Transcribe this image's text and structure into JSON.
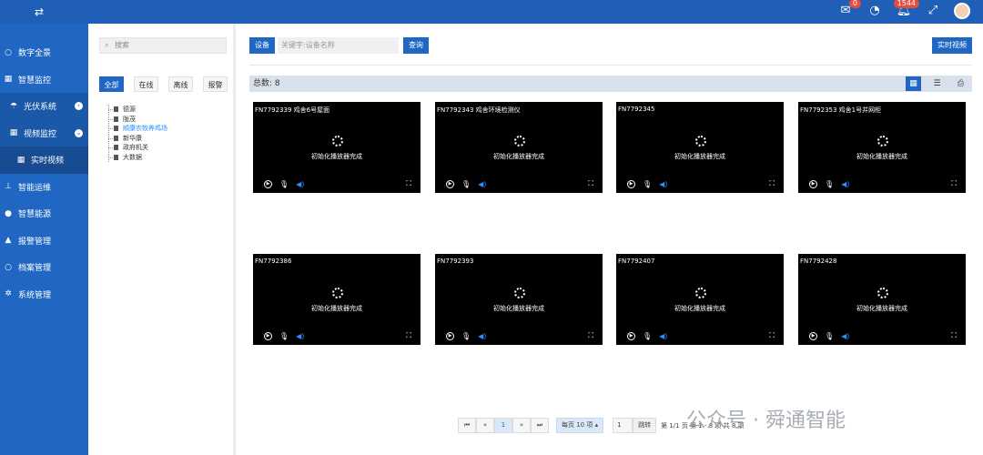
{
  "topbar": {
    "toggle_icon": "swap-icon",
    "mail_badge": "0",
    "alarm_badge": "1544"
  },
  "sidebar": {
    "items": [
      {
        "label": "数字全景",
        "icon": "circle-icon"
      },
      {
        "label": "智慧监控",
        "icon": "grid-icon"
      },
      {
        "label": "光伏系统",
        "icon": "solar-icon"
      },
      {
        "label": "视频监控",
        "icon": "grid-icon"
      },
      {
        "label": "实时视频",
        "icon": "grid-icon"
      },
      {
        "label": "智能运维",
        "icon": "sitemap-icon"
      },
      {
        "label": "智慧能源",
        "icon": "dot-icon"
      },
      {
        "label": "报警管理",
        "icon": "bell-icon"
      },
      {
        "label": "档案管理",
        "icon": "circle-icon"
      },
      {
        "label": "系统管理",
        "icon": "gear-icon"
      }
    ]
  },
  "tree": {
    "search_placeholder": "搜索",
    "filters": [
      "全部",
      "在线",
      "离线",
      "报警"
    ],
    "nodes": [
      "德源",
      "陇茂",
      "顺康农牧养鸡场",
      "新华康",
      "政府机关",
      "大数据"
    ],
    "selected_index": 2
  },
  "toolbar": {
    "device_label": "设备",
    "keyword_placeholder": "关键字:设备名称",
    "query_label": "查询",
    "live_label": "实时视频"
  },
  "summary": {
    "total_text": "总数: 8"
  },
  "tiles": [
    {
      "name": "FN7792339 鸡舍6号屋面"
    },
    {
      "name": "FN7792343 鸡舍环境检测仪"
    },
    {
      "name": "FN7792345"
    },
    {
      "name": "FN7792353 鸡舍1号并网柜"
    },
    {
      "name": "FN7792386"
    },
    {
      "name": "FN7792393"
    },
    {
      "name": "FN7792407"
    },
    {
      "name": "FN7792428"
    }
  ],
  "tile_status": "初始化播放器完成",
  "pagination": {
    "first": "⏮",
    "prev": "«",
    "current": "1",
    "next": "»",
    "last": "⏭",
    "per_page": "每页 10 项",
    "jump_value": "1",
    "jump_label": "跳转",
    "info": "第 1/1 页  第 1 - 8 项  共 8 项"
  },
  "watermark": "公众号 · 舜通智能"
}
